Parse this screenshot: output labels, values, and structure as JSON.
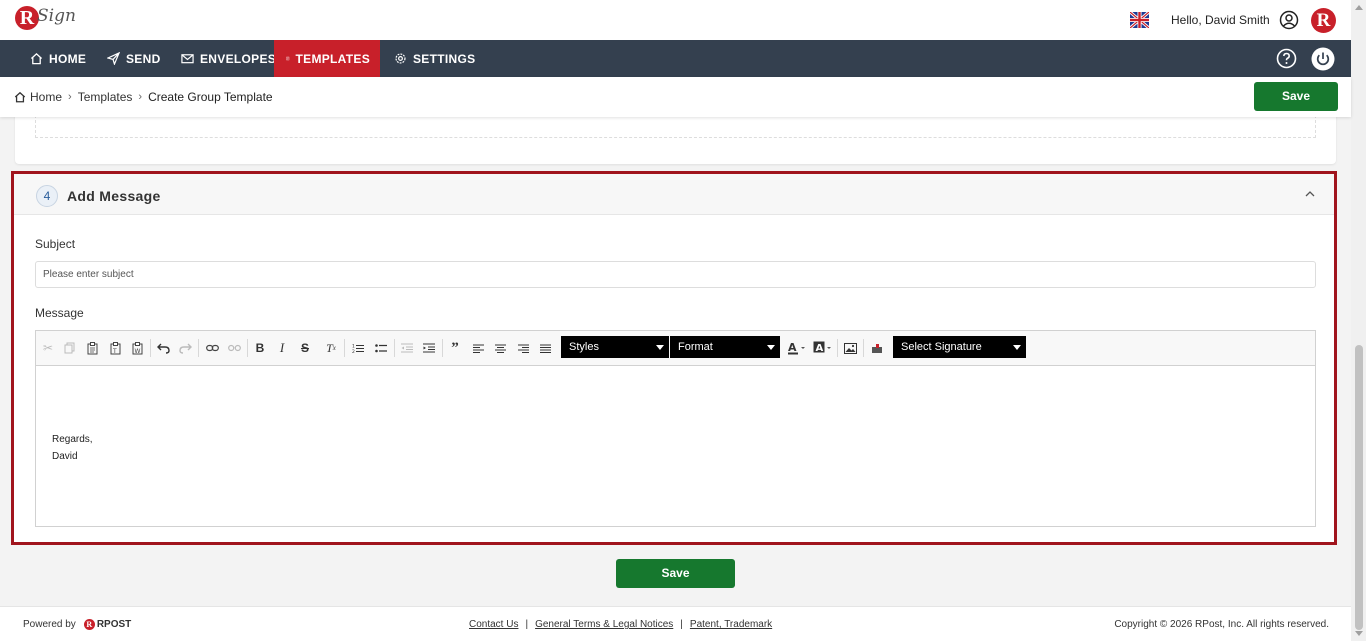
{
  "app": {
    "logo_letter": "R",
    "logo_text": "Sign"
  },
  "header": {
    "greeting": "Hello, David Smith",
    "brand_letter": "R"
  },
  "nav": {
    "items": [
      {
        "label": "HOME",
        "icon": "home-icon"
      },
      {
        "label": "SEND",
        "icon": "send-icon"
      },
      {
        "label": "ENVELOPES",
        "icon": "envelope-icon"
      },
      {
        "label": "TEMPLATES",
        "icon": "template-icon"
      },
      {
        "label": "SETTINGS",
        "icon": "gear-icon"
      }
    ],
    "active": "TEMPLATES"
  },
  "breadcrumb": {
    "home": "Home",
    "templates": "Templates",
    "current": "Create Group Template",
    "separator": "›"
  },
  "toolbar": {
    "save_label": "Save"
  },
  "section": {
    "step": "4",
    "title": "Add Message",
    "subject_label": "Subject",
    "subject_placeholder": "Please enter subject",
    "message_label": "Message",
    "editor": {
      "styles_label": "Styles",
      "format_label": "Format",
      "signature_label": "Select Signature",
      "body_lines": [
        "Regards,",
        "David"
      ]
    }
  },
  "bottom": {
    "save_label": "Save"
  },
  "footer": {
    "powered_by": "Powered by",
    "rpost_letter": "R",
    "rpost_text": "RPOST",
    "links": [
      "Contact Us",
      "General Terms & Legal Notices",
      "Patent, Trademark"
    ],
    "link_separator": "|",
    "copyright": "Copyright © 2026 RPost, Inc. All rights reserved."
  },
  "colors": {
    "nav_bg": "#34404f",
    "active_tab": "#c8202a",
    "save_button": "#16782e",
    "highlight_border": "#a0141d"
  }
}
